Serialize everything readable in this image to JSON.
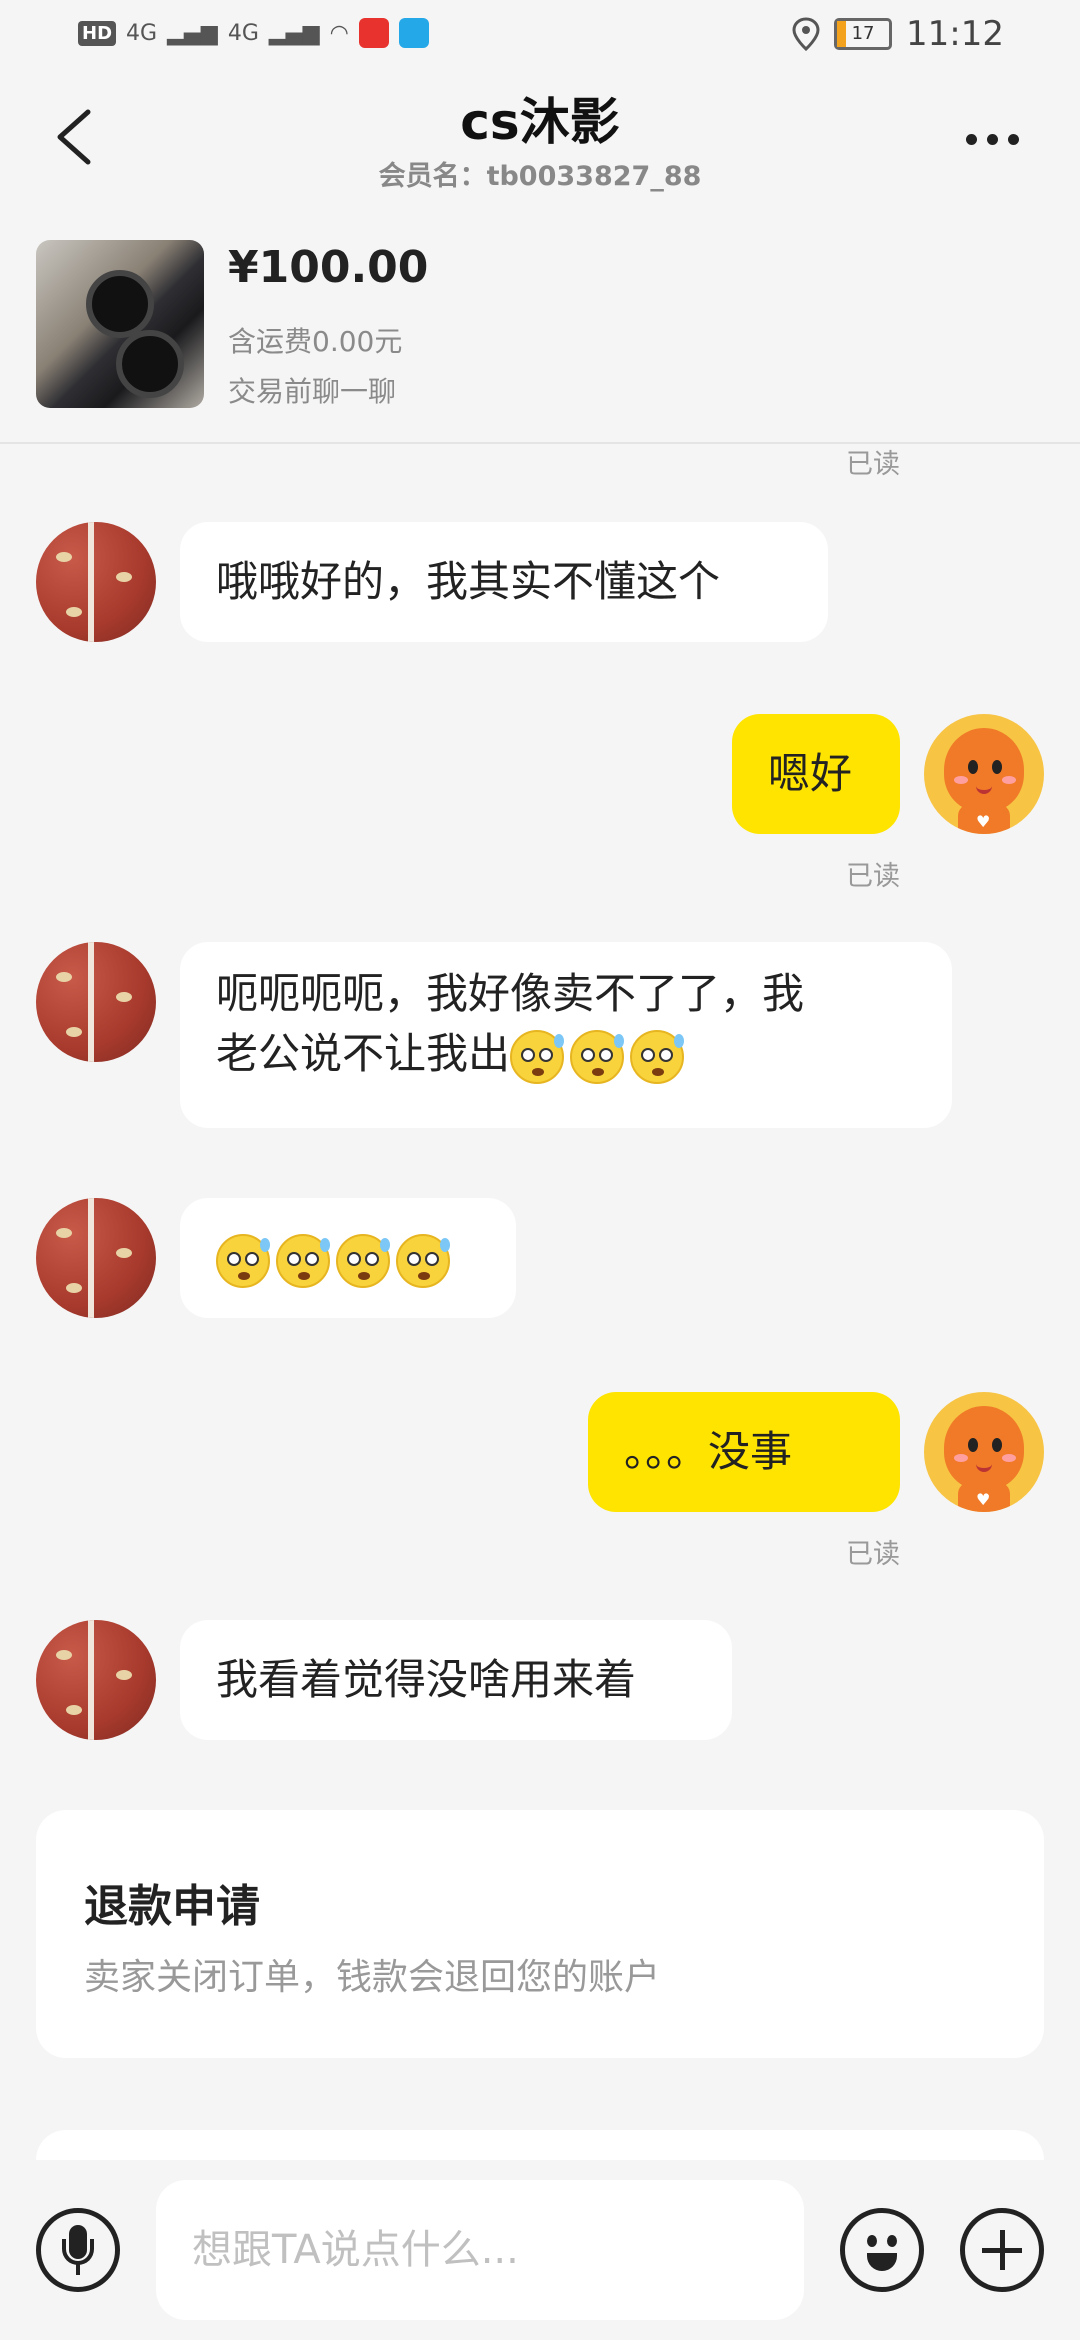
{
  "status_bar": {
    "network_1": "4G",
    "network_2": "4G",
    "hd_label": "HD",
    "battery_level": "17",
    "time": "11:12"
  },
  "header": {
    "title": "cs沐影",
    "subtitle": "会员名：tb0033827_88"
  },
  "product": {
    "price": "¥100.00",
    "shipping": "含运费0.00元",
    "note": "交易前聊一聊"
  },
  "messages": [
    {
      "side": "meta",
      "text": "已读"
    },
    {
      "side": "left",
      "text": "哦哦好的，我其实不懂这个"
    },
    {
      "side": "right",
      "text": "嗯好",
      "status": "已读"
    },
    {
      "side": "left",
      "text": "呃呃呃呃，我好像卖不了了，我老公说不让我出",
      "emoji_count": 3
    },
    {
      "side": "left",
      "text": "",
      "emoji_count": 4
    },
    {
      "side": "right",
      "text": "。。。没事",
      "status": "已读"
    },
    {
      "side": "left",
      "text": "我看着觉得没啥用来着"
    }
  ],
  "message_texts": {
    "m0_read": "已读",
    "m1": "哦哦好的，我其实不懂这个",
    "m2": "嗯好",
    "m2_read": "已读",
    "m3_line1": "呃呃呃呃，我好像卖不了了，我",
    "m3_line2": "老公说不让我出",
    "m5": "。。。没事",
    "m5_read": "已读",
    "m6": "我看着觉得没啥用来着"
  },
  "refund_card": {
    "title": "退款申请",
    "description": "卖家关闭订单，钱款会退回您的账户"
  },
  "input_bar": {
    "placeholder": "想跟TA说点什么..."
  },
  "icons": [
    "back-icon",
    "more-icon",
    "location-icon",
    "mic-icon",
    "emoji-icon",
    "plus-icon"
  ],
  "colors": {
    "accent_bubble": "#ffe400",
    "background": "#f5f5f5",
    "battery": "#f2a21d"
  }
}
